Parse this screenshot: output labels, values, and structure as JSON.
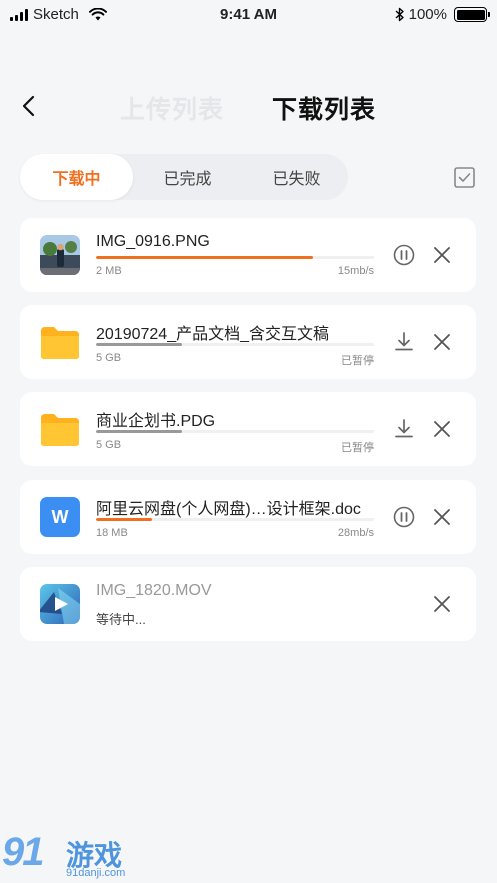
{
  "status_bar": {
    "carrier": "Sketch",
    "time": "9:41 AM",
    "battery": "100%"
  },
  "header": {
    "tabs": [
      "上传列表",
      "下载列表"
    ],
    "active_tab": "下载列表"
  },
  "segments": {
    "items": [
      "下载中",
      "已完成",
      "已失败"
    ],
    "active": "下载中"
  },
  "colors": {
    "accent": "#f07020",
    "paused_bar": "#999999",
    "word_blue": "#3b8ff3",
    "folder_yellow": "#ffc533"
  },
  "files": [
    {
      "name": "IMG_0916.PNG",
      "size": "2 MB",
      "status": "15mb/s",
      "progress": 0.78,
      "state": "downloading",
      "icon": "photo-thumbnail",
      "action_icon": "pause-icon"
    },
    {
      "name": "20190724_产品文档_含交互文稿",
      "size": "5 GB",
      "status": "已暂停",
      "progress": 0.31,
      "state": "paused",
      "icon": "folder-icon",
      "action_icon": "download-icon"
    },
    {
      "name": "商业企划书.PDG",
      "size": "5 GB",
      "status": "已暂停",
      "progress": 0.31,
      "state": "paused",
      "icon": "folder-icon",
      "action_icon": "download-icon"
    },
    {
      "name": "阿里云网盘(个人网盘)…设计框架.doc",
      "size": "18 MB",
      "status": "28mb/s",
      "progress": 0.2,
      "state": "downloading",
      "icon": "word-doc-icon",
      "icon_letter": "W",
      "action_icon": "pause-icon"
    },
    {
      "name": "IMG_1820.MOV",
      "status": "等待中...",
      "state": "waiting",
      "icon": "video-thumbnail"
    }
  ],
  "watermark": {
    "big": "91",
    "cn": "游戏",
    "url": "91danji.com"
  }
}
